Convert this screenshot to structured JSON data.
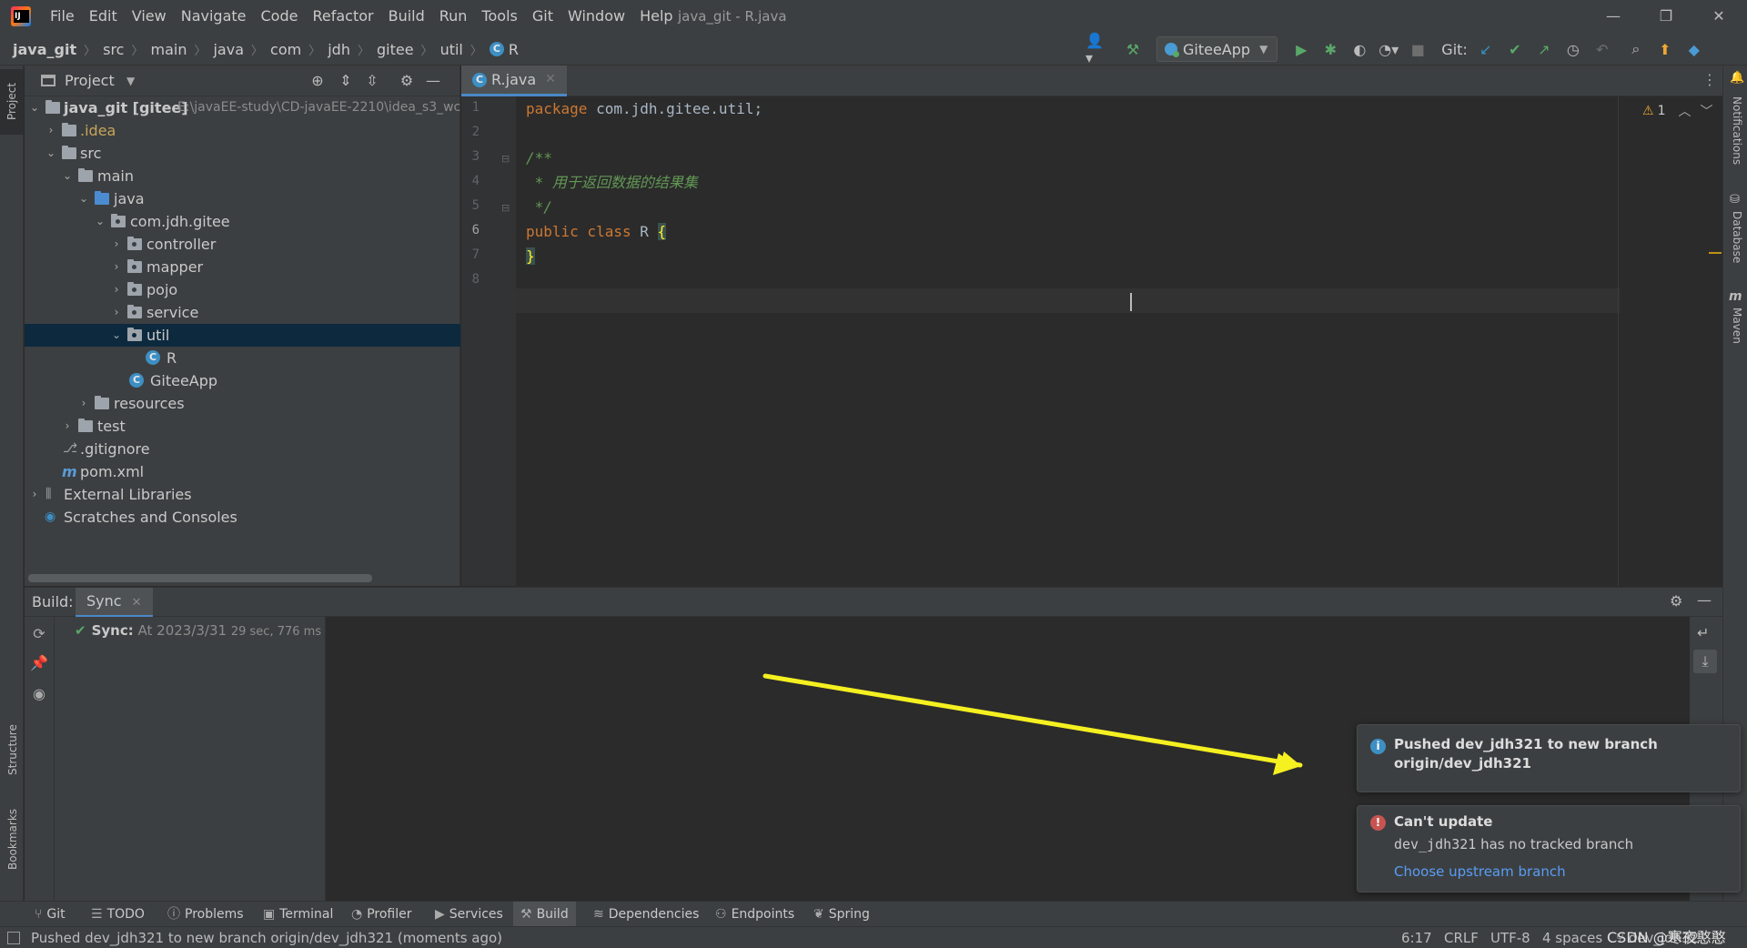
{
  "window": {
    "title": "java_git - R.java",
    "minimize": "—",
    "restore": "❐",
    "close": "✕"
  },
  "menu": [
    "File",
    "Edit",
    "View",
    "Navigate",
    "Code",
    "Refactor",
    "Build",
    "Run",
    "Tools",
    "Git",
    "Window",
    "Help"
  ],
  "breadcrumb": [
    "java_git",
    "src",
    "main",
    "java",
    "com",
    "jdh",
    "gitee",
    "util",
    "R"
  ],
  "toolbar": {
    "run_config": "GiteeApp",
    "git_label": "Git:"
  },
  "left_strip": {
    "project": "Project",
    "structure": "Structure",
    "bookmarks": "Bookmarks"
  },
  "right_strip": {
    "notifications": "Notifications",
    "database": "Database",
    "maven": "Maven"
  },
  "project_panel": {
    "title": "Project",
    "tree": [
      {
        "label": "java_git [gitee]",
        "detail": "E:\\javaEE-study\\CD-javaEE-2210\\idea_s3_wc"
      },
      {
        "label": ".idea"
      },
      {
        "label": "src"
      },
      {
        "label": "main"
      },
      {
        "label": "java"
      },
      {
        "label": "com.jdh.gitee"
      },
      {
        "label": "controller"
      },
      {
        "label": "mapper"
      },
      {
        "label": "pojo"
      },
      {
        "label": "service"
      },
      {
        "label": "util"
      },
      {
        "label": "R"
      },
      {
        "label": "GiteeApp"
      },
      {
        "label": "resources"
      },
      {
        "label": "test"
      },
      {
        "label": ".gitignore"
      },
      {
        "label": "pom.xml"
      },
      {
        "label": "External Libraries"
      },
      {
        "label": "Scratches and Consoles"
      }
    ]
  },
  "editor": {
    "tab": "R.java",
    "line_numbers": [
      "1",
      "2",
      "3",
      "4",
      "5",
      "6",
      "7",
      "8"
    ],
    "code": {
      "l1_kw": "package",
      "l1_rest": " com.jdh.gitee.util;",
      "l3": "/**",
      "l4": " * 用于返回数据的结果集",
      "l5": " */",
      "l6_kw": "public class",
      "l6_name": " R ",
      "l6_brace": "{",
      "l7": "}"
    },
    "warnings_count": "1"
  },
  "build": {
    "label": "Build:",
    "tab": "Sync",
    "sync_title": "Sync:",
    "sync_time": "At 2023/3/31",
    "sync_duration": "29 sec, 776 ms"
  },
  "notifications": [
    {
      "type": "info",
      "title_line1": "Pushed dev_jdh321 to new branch",
      "title_line2": "origin/dev_jdh321"
    },
    {
      "type": "error",
      "title": "Can't update",
      "branch": "dev_jdh321",
      "body": " has no tracked branch",
      "link": "Choose upstream branch"
    }
  ],
  "bottom_tabs": [
    "Git",
    "TODO",
    "Problems",
    "Terminal",
    "Profiler",
    "Services",
    "Build",
    "Dependencies",
    "Endpoints",
    "Spring"
  ],
  "status": {
    "message": "Pushed dev_jdh321 to new branch origin/dev_jdh321 (moments ago)",
    "position": "6:17",
    "line_sep": "CRLF",
    "encoding": "UTF-8",
    "indent": "4 spaces",
    "branch": "dev_jdh32",
    "watermark": "CSDN @寒夜憨憨"
  },
  "colors": {
    "background": "#2b2b2b",
    "panel": "#3c3f41",
    "selection": "#0d293e",
    "keyword": "#cc7832",
    "comment": "#629755",
    "link": "#589df6",
    "annotation_arrow": "#f5f020"
  }
}
